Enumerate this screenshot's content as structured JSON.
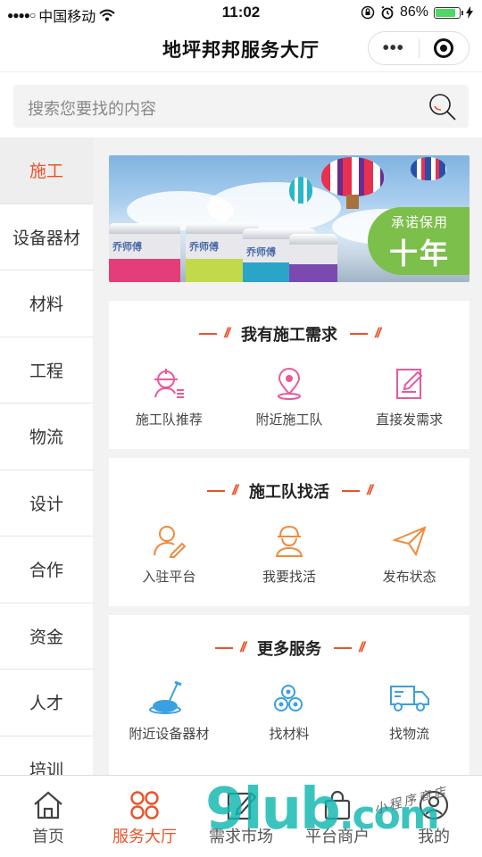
{
  "status_bar": {
    "signal_dots": "●●●●○",
    "carrier": "中国移动",
    "time": "11:02",
    "battery": "86%",
    "battery_level": 0.86
  },
  "header": {
    "title": "地坪邦邦服务大厅"
  },
  "search": {
    "placeholder": "搜索您要找的内容"
  },
  "sidebar": {
    "items": [
      {
        "label": "施工",
        "active": true
      },
      {
        "label": "设备器材"
      },
      {
        "label": "材料"
      },
      {
        "label": "工程"
      },
      {
        "label": "物流"
      },
      {
        "label": "设计"
      },
      {
        "label": "合作"
      },
      {
        "label": "资金"
      },
      {
        "label": "人才"
      },
      {
        "label": "培训"
      }
    ]
  },
  "banner": {
    "badge_top": "承诺保用",
    "badge_main": "十年",
    "brand": "乔师傅"
  },
  "sections": [
    {
      "title": "我有施工需求",
      "items": [
        {
          "label": "施工队推荐",
          "icon": "crew-recommend-icon"
        },
        {
          "label": "附近施工队",
          "icon": "location-pin-icon"
        },
        {
          "label": "直接发需求",
          "icon": "edit-document-icon"
        }
      ],
      "color": "#e85a9b"
    },
    {
      "title": "施工队找活",
      "items": [
        {
          "label": "入驻平台",
          "icon": "user-edit-icon"
        },
        {
          "label": "我要找活",
          "icon": "worker-icon"
        },
        {
          "label": "发布状态",
          "icon": "paper-plane-icon"
        }
      ],
      "color": "#f08a3c"
    },
    {
      "title": "更多服务",
      "items": [
        {
          "label": "附近设备器材",
          "icon": "floor-machine-icon"
        },
        {
          "label": "找材料",
          "icon": "pipes-icon"
        },
        {
          "label": "找物流",
          "icon": "truck-icon"
        }
      ],
      "color": "#3aa0e0"
    }
  ],
  "tabbar": {
    "items": [
      {
        "label": "首页",
        "icon": "home-icon"
      },
      {
        "label": "服务大厅",
        "icon": "grid-icon",
        "active": true
      },
      {
        "label": "需求市场",
        "icon": "edit-icon"
      },
      {
        "label": "平台商户",
        "icon": "bag-icon"
      },
      {
        "label": "我的",
        "icon": "profile-icon"
      }
    ]
  },
  "watermark": {
    "text": "9lub",
    "domain": ".com",
    "script": "小程序商店"
  },
  "colors": {
    "accent": "#e8542a",
    "green": "#7cbf4a"
  }
}
